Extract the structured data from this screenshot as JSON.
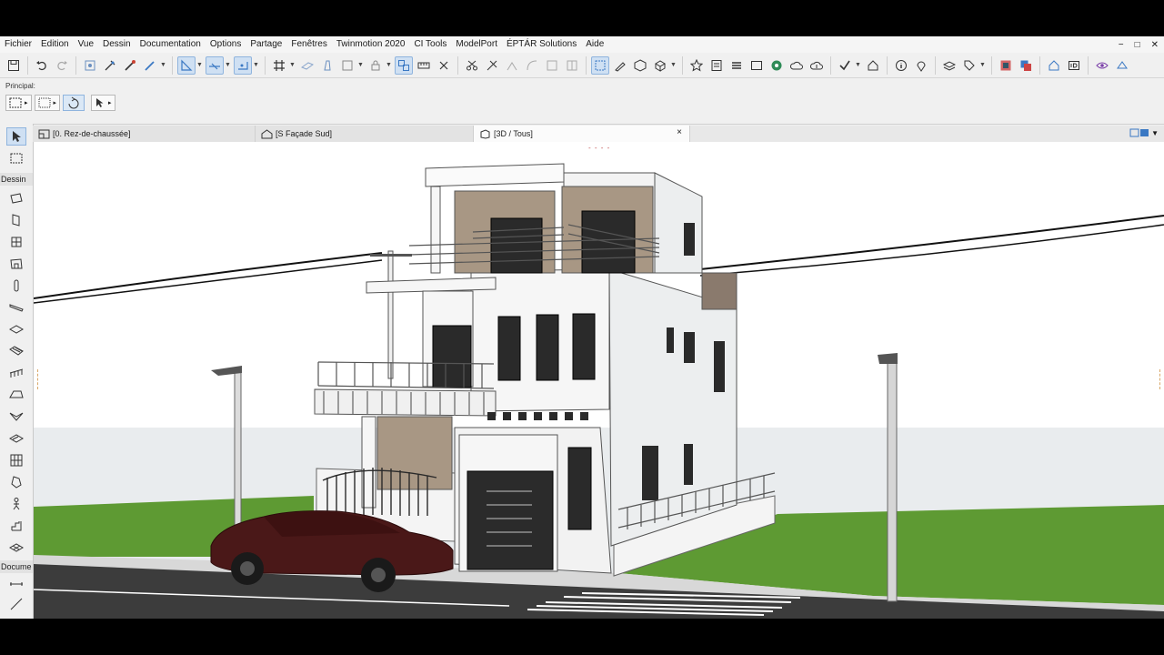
{
  "menu": {
    "items": [
      "Fichier",
      "Edition",
      "Vue",
      "Dessin",
      "Documentation",
      "Options",
      "Partage",
      "Fenêtres",
      "Twinmotion 2020",
      "CI Tools",
      "ModelPort",
      "ÉPTÁR Solutions",
      "Aide"
    ],
    "window_controls": [
      "−",
      "□",
      "✕"
    ]
  },
  "infobox": {
    "label": "Principal:"
  },
  "toolbox": {
    "sections": [
      "Dessin",
      "Docume"
    ]
  },
  "tabs": [
    {
      "label": "[0. Rez-de-chaussée]",
      "icon": "floor-plan-icon"
    },
    {
      "label": "[S Façade Sud]",
      "icon": "elevation-icon"
    },
    {
      "label": "[3D / Tous]",
      "icon": "3d-window-icon",
      "close": "×"
    }
  ],
  "viewport": {
    "marker": "- - - -"
  },
  "colors": {
    "accent": "#3a78c3",
    "active_bg": "#cfe0f3",
    "sky": "#ffffff",
    "ground": "#e9ecee",
    "grass": "#5d9a32",
    "road": "#3d3d3d"
  }
}
